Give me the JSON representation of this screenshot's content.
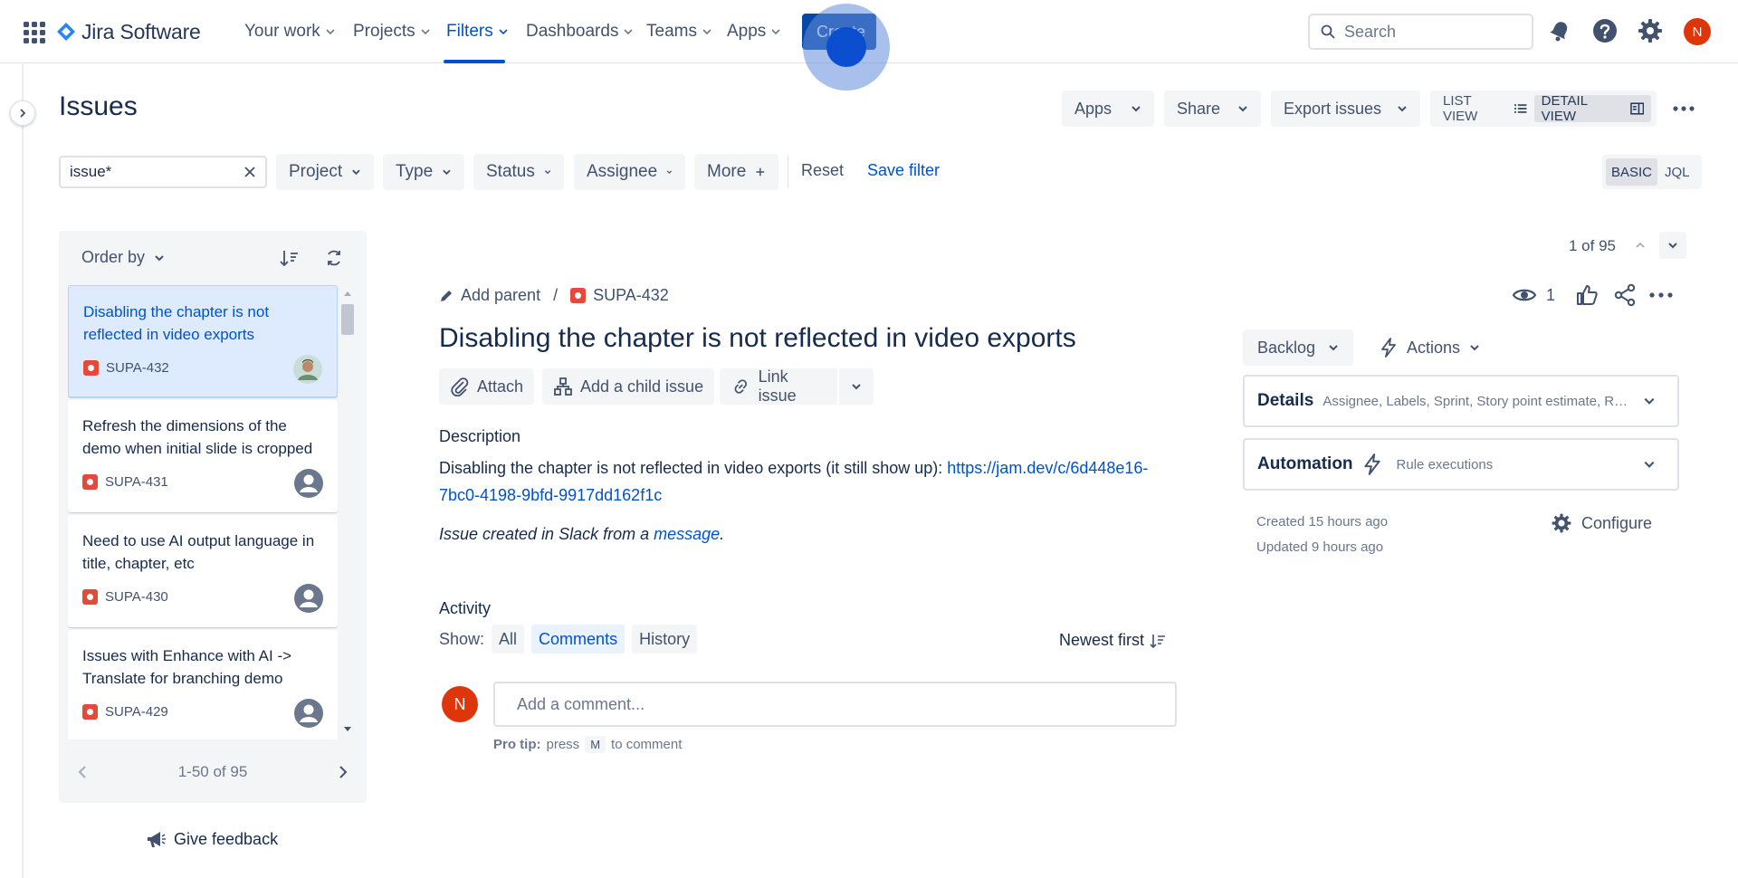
{
  "topnav": {
    "brand": "Jira Software",
    "items": [
      {
        "label": "Your work"
      },
      {
        "label": "Projects"
      },
      {
        "label": "Filters"
      },
      {
        "label": "Dashboards"
      },
      {
        "label": "Teams"
      },
      {
        "label": "Apps"
      }
    ],
    "create_label": "Create",
    "search_placeholder": "Search",
    "user_initial": "N"
  },
  "header": {
    "title": "Issues",
    "apps_label": "Apps",
    "share_label": "Share",
    "export_label": "Export issues",
    "list_view_label": "LIST VIEW",
    "detail_view_label": "DETAIL VIEW"
  },
  "filters": {
    "search_value": "issue*",
    "project": "Project",
    "type": "Type",
    "status": "Status",
    "assignee": "Assignee",
    "more": "More",
    "reset": "Reset",
    "save_filter": "Save filter",
    "basic": "BASIC",
    "jql": "JQL"
  },
  "list": {
    "order_by": "Order by",
    "cards": [
      {
        "title": "Disabling the chapter is not reflected in video exports",
        "key": "SUPA-432",
        "selected": true
      },
      {
        "title": "Refresh the dimensions of the demo when initial slide is cropped",
        "key": "SUPA-431"
      },
      {
        "title": "Need to use AI output language in title, chapter, etc",
        "key": "SUPA-430"
      },
      {
        "title": "Issues with Enhance with AI -> Translate for branching demo",
        "key": "SUPA-429"
      }
    ],
    "pager_text": "1-50 of 95",
    "feedback": "Give feedback"
  },
  "detail": {
    "position": "1 of 95",
    "add_parent": "Add parent",
    "key": "SUPA-432",
    "title": "Disabling the chapter is not reflected in video exports",
    "attach": "Attach",
    "add_child": "Add a child issue",
    "link_issue": "Link issue",
    "description_label": "Description",
    "description_text": "Disabling the chapter is not reflected in video exports (it still show up): ",
    "description_link": "https://jam.dev/c/6d448e16-7bc0-4198-9bfd-9917dd162f1c",
    "slack_note_prefix": "Issue created in Slack from a ",
    "slack_note_link": "message",
    "slack_note_suffix": ".",
    "activity_label": "Activity",
    "show_label": "Show:",
    "show_options": [
      "All",
      "Comments",
      "History"
    ],
    "newest_first": "Newest first",
    "comment_placeholder": "Add a comment...",
    "pro_tip_bold": "Pro tip:",
    "pro_tip_press": "press",
    "pro_tip_key": "M",
    "pro_tip_suffix": "to comment"
  },
  "sidebar": {
    "watchers": "1",
    "status": "Backlog",
    "actions": "Actions",
    "details_title": "Details",
    "details_sub": "Assignee, Labels, Sprint, Story point estimate, Repo...",
    "automation_title": "Automation",
    "automation_sub": "Rule executions",
    "created": "Created 15 hours ago",
    "updated": "Updated 9 hours ago",
    "configure": "Configure"
  },
  "colors": {
    "brand_blue": "#0052cc",
    "create_bg": "#0747a6",
    "bug_red": "#e5493a",
    "avatar_red": "#de350b"
  }
}
